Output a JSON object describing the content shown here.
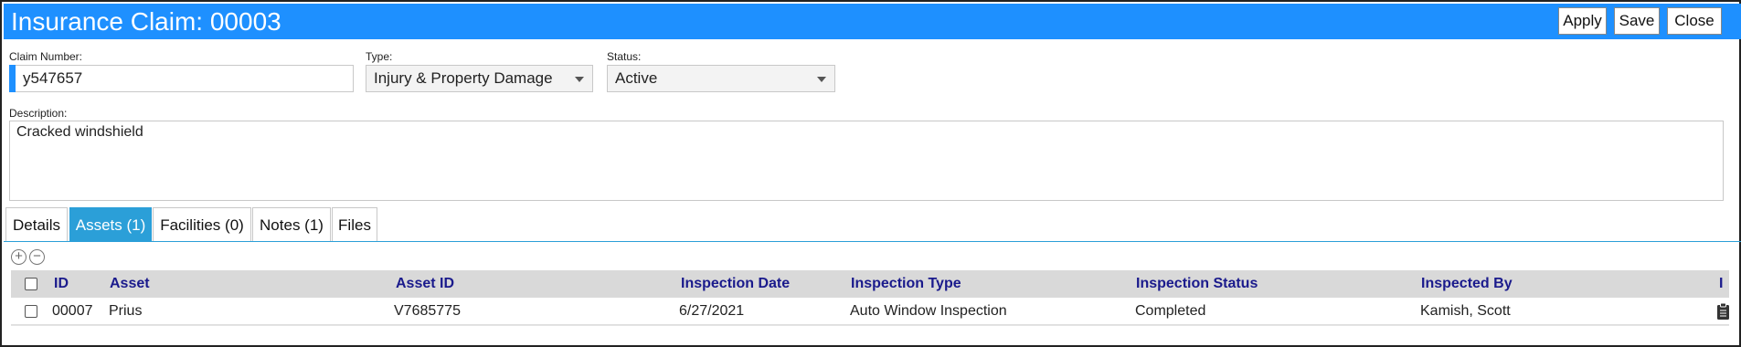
{
  "header": {
    "title": "Insurance Claim: 00003",
    "apply_label": "Apply",
    "save_label": "Save",
    "close_label": "Close"
  },
  "form": {
    "claim_number_label": "Claim Number:",
    "claim_number_value": "y547657",
    "type_label": "Type:",
    "type_value": "Injury & Property Damage",
    "status_label": "Status:",
    "status_value": "Active",
    "description_label": "Description:",
    "description_value": "Cracked windshield"
  },
  "tabs": [
    {
      "label": "Details",
      "active": false
    },
    {
      "label": "Assets (1)",
      "active": true
    },
    {
      "label": "Facilities (0)",
      "active": false
    },
    {
      "label": "Notes (1)",
      "active": false
    },
    {
      "label": "Files",
      "active": false
    }
  ],
  "grid": {
    "columns": [
      "ID",
      "Asset",
      "Asset ID",
      "Inspection Date",
      "Inspection Type",
      "Inspection Status",
      "Inspected By",
      "I"
    ],
    "rows": [
      {
        "id": "00007",
        "asset": "Prius",
        "asset_id": "V7685775",
        "inspection_date": "6/27/2021",
        "inspection_type": "Auto Window Inspection",
        "inspection_status": "Completed",
        "inspected_by": "Kamish, Scott",
        "icon": "clipboard-icon"
      }
    ]
  },
  "icons": {
    "add": "plus-circle-icon",
    "remove": "minus-circle-icon"
  },
  "colors": {
    "header_bg": "#1e90ff",
    "active_tab": "#2b9fd8",
    "grid_header_text": "#1a1a8c"
  }
}
